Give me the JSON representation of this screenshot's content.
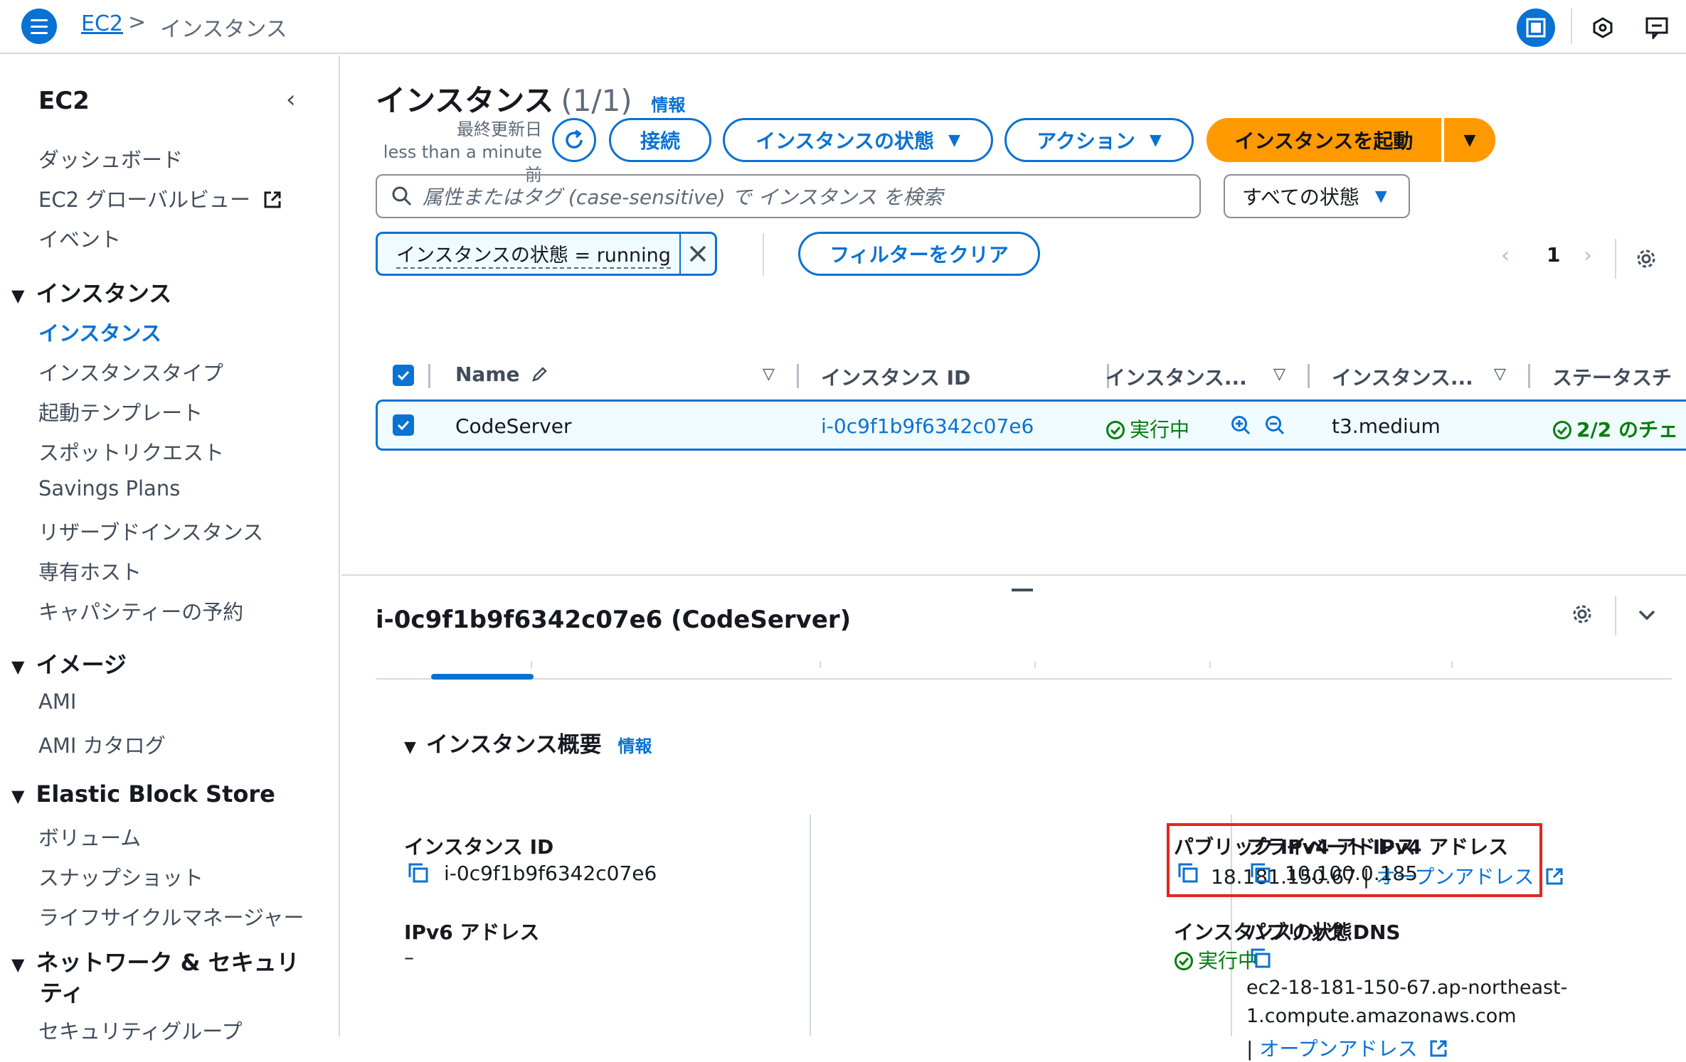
{
  "topbar": {
    "breadcrumb_root": "EC2",
    "breadcrumb_sep": ">",
    "breadcrumb_current": "インスタンス"
  },
  "sidebar": {
    "title": "EC2",
    "top_items": [
      "ダッシュボード",
      "EC2 グローバルビュー",
      "イベント"
    ],
    "sections": [
      {
        "title": "インスタンス",
        "items": [
          "インスタンス",
          "インスタンスタイプ",
          "起動テンプレート",
          "スポットリクエスト",
          "Savings Plans",
          "リザーブドインスタンス",
          "専有ホスト",
          "キャパシティーの予約"
        ]
      },
      {
        "title": "イメージ",
        "items": [
          "AMI",
          "AMI カタログ"
        ]
      },
      {
        "title": "Elastic Block Store",
        "items": [
          "ボリューム",
          "スナップショット",
          "ライフサイクルマネージャー"
        ]
      },
      {
        "title_line1": "ネットワーク & セキュリ",
        "title_line2": "ティ",
        "items": [
          "セキュリティグループ"
        ]
      }
    ]
  },
  "header": {
    "title": "インスタンス",
    "count": "(1/1)",
    "info": "情報",
    "last_updated_label": "最終更新日",
    "last_updated_value": "less than a minute 前",
    "connect": "接続",
    "instance_state": "インスタンスの状態",
    "actions": "アクション",
    "launch": "インスタンスを起動"
  },
  "search": {
    "placeholder": "属性またはタグ (case-sensitive) で インスタンス を検索",
    "state_filter": "すべての状態"
  },
  "filter": {
    "token": "インスタンスの状態 = running",
    "clear": "フィルターをクリア"
  },
  "pagination": {
    "current_page": "1"
  },
  "table": {
    "columns": [
      "Name",
      "インスタンス ID",
      "インスタンス...",
      "インスタンス...",
      "ステータスチ"
    ],
    "row": {
      "name": "CodeServer",
      "instance_id": "i-0c9f1b9f6342c07e6",
      "state": "実行中",
      "type": "t3.medium",
      "status_check": "2/2 のチェ"
    }
  },
  "detail": {
    "title": "i-0c9f1b9f6342c07e6 (CodeServer)",
    "section_title": "インスタンス概要",
    "section_info": "情報",
    "instance_id_label": "インスタンス ID",
    "instance_id_value": "i-0c9f1b9f6342c07e6",
    "public_ip_label": "パブリック IPv4 アドレス",
    "public_ip_value": "18.181.150.67",
    "open_address": "オープンアドレス",
    "private_ip_label": "プライベート IPv4 アドレス",
    "private_ip_value": "10.100.0.185",
    "ipv6_label": "IPv6 アドレス",
    "ipv6_value": "–",
    "state_label": "インスタンスの状態",
    "state_value": "実行中",
    "public_dns_label": "パブリック DNS",
    "public_dns_line1": "ec2-18-181-150-67.ap-northeast-",
    "public_dns_line2": "1.compute.amazonaws.com",
    "public_dns_open": "オープンアドレス"
  },
  "colors": {
    "primary": "#0972d3",
    "accent": "#ff9900",
    "success": "#037f0c",
    "highlight": "#e3261c"
  }
}
